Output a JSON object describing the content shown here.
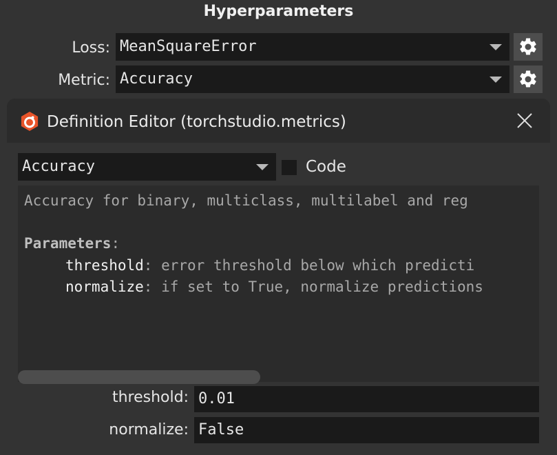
{
  "hyperparameters": {
    "title": "Hyperparameters",
    "loss": {
      "label": "Loss:",
      "value": "MeanSquareError"
    },
    "metric": {
      "label": "Metric:",
      "value": "Accuracy"
    }
  },
  "definition_editor": {
    "title": "Definition Editor (torchstudio.metrics)",
    "definition_select": {
      "value": "Accuracy"
    },
    "code_checkbox": {
      "label": "Code",
      "checked": false
    },
    "doc": {
      "summary": "Accuracy for binary, multiclass, multilabel and reg",
      "parameters_heading": "Parameters",
      "parameters_colon": ":",
      "params": [
        {
          "name": "threshold",
          "sep": ":",
          "desc": " error threshold below which predicti"
        },
        {
          "name": "normalize",
          "sep": ":",
          "desc": " if set to True, normalize predictions"
        }
      ]
    },
    "params": [
      {
        "label": "threshold:",
        "value": "0.01"
      },
      {
        "label": "normalize:",
        "value": "False"
      }
    ]
  },
  "colors": {
    "accent": "#e8542a",
    "panel": "#333333",
    "field": "#1a1a1a"
  },
  "icons": [
    "gear-icon",
    "torchstudio-logo-icon",
    "close-icon",
    "chevron-down-icon"
  ]
}
